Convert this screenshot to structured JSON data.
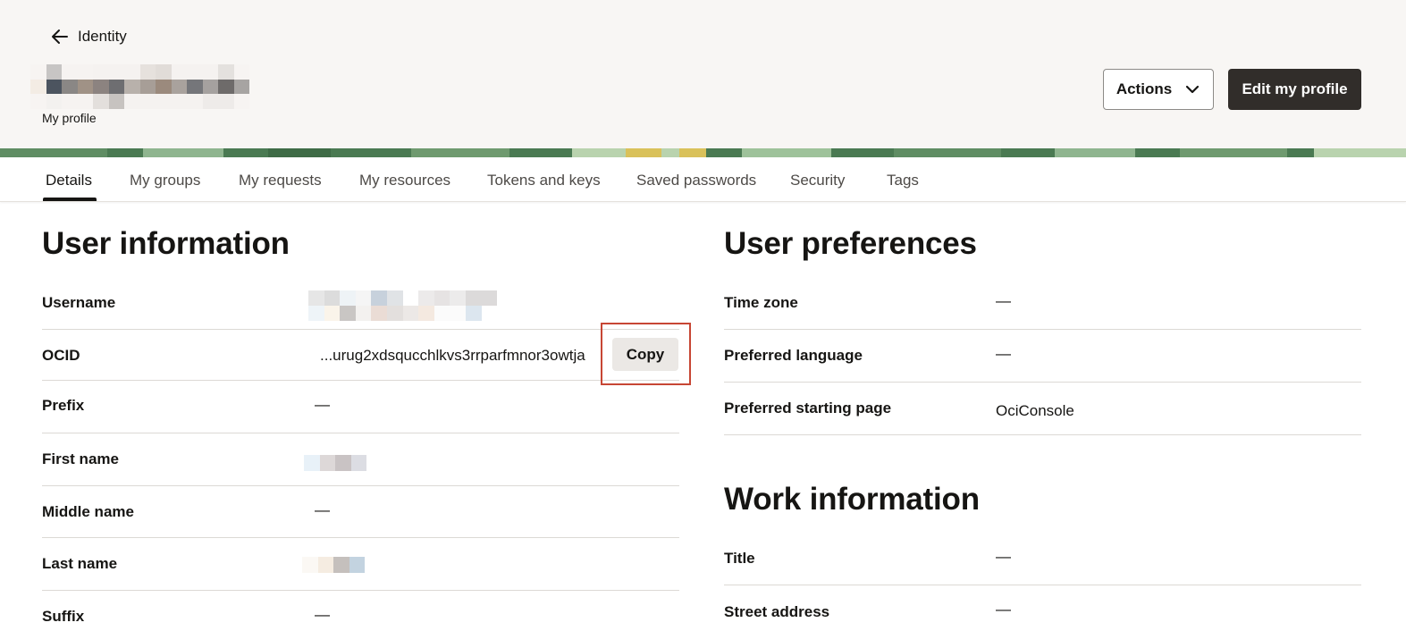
{
  "header": {
    "back_label": "Identity",
    "subtitle": "My profile",
    "actions_label": "Actions",
    "edit_label": "Edit my profile"
  },
  "tabs": [
    {
      "label": "Details",
      "active": true
    },
    {
      "label": "My groups"
    },
    {
      "label": "My requests"
    },
    {
      "label": "My resources"
    },
    {
      "label": "Tokens and keys"
    },
    {
      "label": "Saved passwords"
    },
    {
      "label": "Security"
    },
    {
      "label": "Tags"
    }
  ],
  "user_information": {
    "title": "User information",
    "rows": [
      {
        "label": "Username",
        "value": ""
      },
      {
        "label": "OCID",
        "value": "...urug2xdsqucchlkvs3rrparfmnor3owtja",
        "copy_label": "Copy"
      },
      {
        "label": "Prefix",
        "value": "—"
      },
      {
        "label": "First name",
        "value": ""
      },
      {
        "label": "Middle name",
        "value": "—"
      },
      {
        "label": "Last name",
        "value": ""
      },
      {
        "label": "Suffix",
        "value": "—"
      }
    ]
  },
  "user_preferences": {
    "title": "User preferences",
    "rows": [
      {
        "label": "Time zone",
        "value": "—"
      },
      {
        "label": "Preferred language",
        "value": "—"
      },
      {
        "label": "Preferred starting page",
        "value": "OciConsole"
      }
    ]
  },
  "work_information": {
    "title": "Work information",
    "rows": [
      {
        "label": "Title",
        "value": "—"
      },
      {
        "label": "Street address",
        "value": "—"
      }
    ]
  },
  "colors": {
    "header_bg": "#f8f6f4",
    "primary_button": "#312d2a",
    "highlight": "#c74634",
    "banner_green": "#4a7a52"
  }
}
